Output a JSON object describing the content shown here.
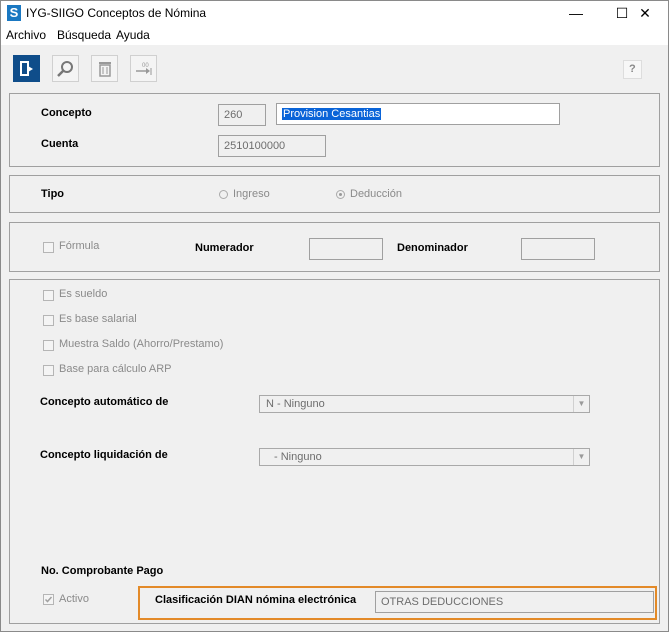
{
  "window": {
    "title": "IYG-SIIGO Conceptos de Nómina",
    "icon_letter": "S",
    "minimize": "—",
    "maximize": "☐",
    "close": "✕"
  },
  "menu": [
    "Archivo",
    "Búsqueda",
    "Ayuda"
  ],
  "toolbar": {
    "help_label": "?"
  },
  "concepto": {
    "label": "Concepto",
    "code": "260",
    "name": "Provision Cesantias",
    "cuenta_label": "Cuenta",
    "cuenta": "2510100000"
  },
  "tipo": {
    "label": "Tipo",
    "options": [
      "Ingreso",
      "Deducción"
    ],
    "selected": "Deducción"
  },
  "formula": {
    "formula_label": "Fórmula",
    "numerador_label": "Numerador",
    "numerador_value": "",
    "denominador_label": "Denominador",
    "denominador_value": ""
  },
  "options": {
    "checkboxes": [
      "Es sueldo",
      "Es base salarial",
      "Muestra Saldo (Ahorro/Prestamo)",
      "Base para cálculo ARP"
    ],
    "concepto_automatico_label": "Concepto automático de",
    "concepto_automatico_value": "N - Ninguno",
    "concepto_liquidacion_label": "Concepto liquidación de",
    "concepto_liquidacion_value": "- Ninguno",
    "comprobante_label": "No. Comprobante Pago",
    "activo_label": "Activo",
    "activo_checked": true,
    "clasificacion_label": "Clasificación DIAN nómina electrónica",
    "clasificacion_value": "OTRAS DEDUCCIONES"
  },
  "colors": {
    "highlight_border": "#e38a28",
    "selection": "#0a64d8",
    "active_tool": "#0f4d8a"
  }
}
